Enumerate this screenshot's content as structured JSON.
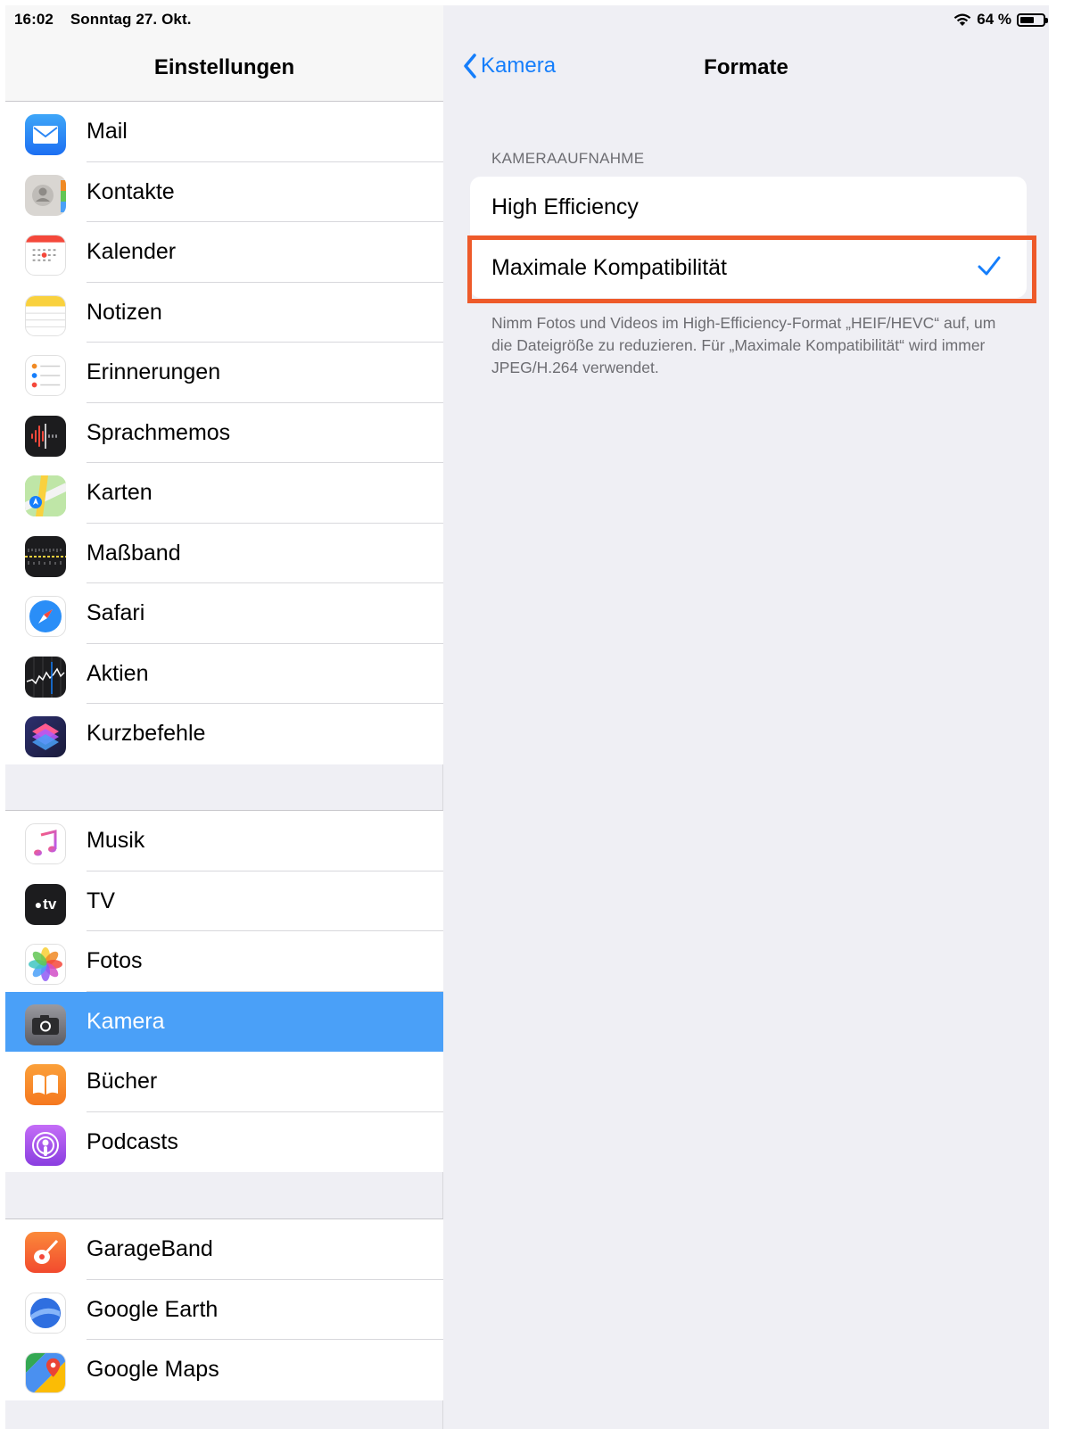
{
  "status_bar": {
    "time": "16:02",
    "date": "Sonntag 27. Okt.",
    "battery_percent": "64 %",
    "battery_level": 0.64
  },
  "sidebar": {
    "title": "Einstellungen",
    "groups": [
      [
        {
          "label": "Mail",
          "icon": "mail-icon"
        },
        {
          "label": "Kontakte",
          "icon": "contacts-icon"
        },
        {
          "label": "Kalender",
          "icon": "calendar-icon"
        },
        {
          "label": "Notizen",
          "icon": "notes-icon"
        },
        {
          "label": "Erinnerungen",
          "icon": "reminders-icon"
        },
        {
          "label": "Sprachmemos",
          "icon": "voice-memos-icon"
        },
        {
          "label": "Karten",
          "icon": "maps-icon"
        },
        {
          "label": "Maßband",
          "icon": "measure-icon"
        },
        {
          "label": "Safari",
          "icon": "safari-icon"
        },
        {
          "label": "Aktien",
          "icon": "stocks-icon"
        },
        {
          "label": "Kurzbefehle",
          "icon": "shortcuts-icon"
        }
      ],
      [
        {
          "label": "Musik",
          "icon": "music-icon"
        },
        {
          "label": "TV",
          "icon": "apple-tv-icon"
        },
        {
          "label": "Fotos",
          "icon": "photos-icon"
        },
        {
          "label": "Kamera",
          "icon": "camera-icon",
          "selected": true
        },
        {
          "label": "Bücher",
          "icon": "books-icon"
        },
        {
          "label": "Podcasts",
          "icon": "podcasts-icon"
        }
      ],
      [
        {
          "label": "GarageBand",
          "icon": "garageband-icon"
        },
        {
          "label": "Google Earth",
          "icon": "google-earth-icon"
        },
        {
          "label": "Google Maps",
          "icon": "google-maps-icon"
        }
      ]
    ]
  },
  "detail": {
    "back_label": "Kamera",
    "title": "Formate",
    "section_header": "KAMERAAUFNAHME",
    "options": [
      {
        "label": "High Efficiency",
        "checked": false
      },
      {
        "label": "Maximale Kompatibilität",
        "checked": true
      }
    ],
    "footer_note": "Nimm Fotos und Videos im High-Efficiency-Format „HEIF/HEVC“ auf, um die Dateigröße zu reduzieren. Für „Maximale Kompatibilität“ wird immer JPEG/H.264 verwendet.",
    "highlight_color": "#ee5a2a",
    "accent_color": "#157efb",
    "selected_row_color": "#4aa0f8"
  }
}
